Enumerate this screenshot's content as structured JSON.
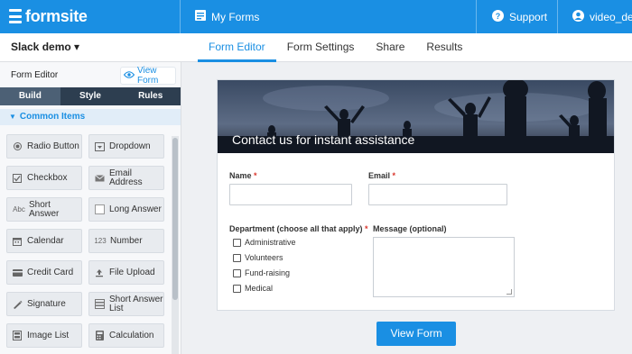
{
  "app": {
    "name": "formsite"
  },
  "topnav": {
    "my_forms": "My Forms",
    "support": "Support",
    "user": "video_de"
  },
  "form": {
    "name": "Slack demo ▾"
  },
  "tabs": [
    {
      "label": "Form Editor",
      "active": true
    },
    {
      "label": "Form Settings",
      "active": false
    },
    {
      "label": "Share",
      "active": false
    },
    {
      "label": "Results",
      "active": false
    }
  ],
  "sidebar": {
    "title": "Form Editor",
    "view_form": "View Form",
    "tabs": [
      "Build",
      "Style",
      "Rules"
    ],
    "section": "Common Items",
    "items": [
      {
        "label": "Radio Button",
        "icon": "radio-icon"
      },
      {
        "label": "Dropdown",
        "icon": "dropdown-icon"
      },
      {
        "label": "Checkbox",
        "icon": "checkbox-icon"
      },
      {
        "label": "Email Address",
        "icon": "email-icon"
      },
      {
        "label": "Short Answer",
        "icon": "abc-icon",
        "icon_text": "Abc"
      },
      {
        "label": "Long Answer",
        "icon": "long-answer-icon"
      },
      {
        "label": "Calendar",
        "icon": "calendar-icon"
      },
      {
        "label": "Number",
        "icon": "number-icon",
        "icon_text": "123"
      },
      {
        "label": "Credit Card",
        "icon": "credit-card-icon"
      },
      {
        "label": "File Upload",
        "icon": "upload-icon"
      },
      {
        "label": "Signature",
        "icon": "signature-icon"
      },
      {
        "label": "Short Answer List",
        "icon": "list-icon"
      },
      {
        "label": "Image List",
        "icon": "image-list-icon"
      },
      {
        "label": "Calculation",
        "icon": "calculator-icon"
      }
    ]
  },
  "canvas": {
    "banner_title": "Contact us for instant assistance",
    "name_label": "Name",
    "email_label": "Email",
    "department_label": "Department (choose all that apply)",
    "message_label": "Message (optional)",
    "required_mark": "*",
    "departments": [
      "Administrative",
      "Volunteers",
      "Fund-raising",
      "Medical"
    ],
    "view_form_button": "View Form"
  },
  "colors": {
    "brand": "#1a8fe3",
    "sidebar_tabs": "#2d3e50",
    "required": "#d9342b"
  }
}
